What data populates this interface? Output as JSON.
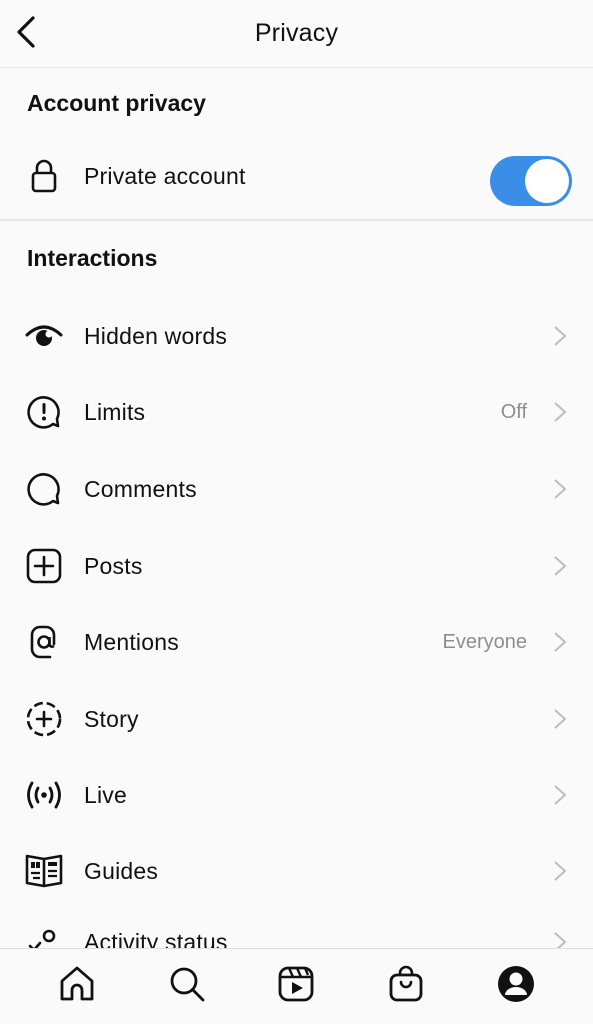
{
  "header": {
    "title": "Privacy",
    "back_icon": "chevron-left-icon"
  },
  "account_privacy": {
    "section_title": "Account privacy",
    "private_account": {
      "label": "Private account",
      "icon": "lock-icon",
      "enabled": true,
      "toggle_color": "#3b8ee8"
    }
  },
  "interactions": {
    "section_title": "Interactions",
    "items": [
      {
        "label": "Hidden words",
        "icon": "hidden-words-icon",
        "value": ""
      },
      {
        "label": "Limits",
        "icon": "limits-icon",
        "value": "Off"
      },
      {
        "label": "Comments",
        "icon": "comment-icon",
        "value": ""
      },
      {
        "label": "Posts",
        "icon": "add-post-icon",
        "value": ""
      },
      {
        "label": "Mentions",
        "icon": "at-sign-icon",
        "value": "Everyone"
      },
      {
        "label": "Story",
        "icon": "story-add-icon",
        "value": ""
      },
      {
        "label": "Live",
        "icon": "live-icon",
        "value": ""
      },
      {
        "label": "Guides",
        "icon": "guides-icon",
        "value": ""
      },
      {
        "label": "Activity status",
        "icon": "activity-status-icon",
        "value": ""
      }
    ]
  },
  "tabbar": {
    "items": [
      {
        "name": "home",
        "icon": "home-icon"
      },
      {
        "name": "search",
        "icon": "search-icon"
      },
      {
        "name": "reels",
        "icon": "reels-icon"
      },
      {
        "name": "shop",
        "icon": "shop-bag-icon"
      },
      {
        "name": "profile",
        "icon": "profile-icon"
      }
    ]
  }
}
